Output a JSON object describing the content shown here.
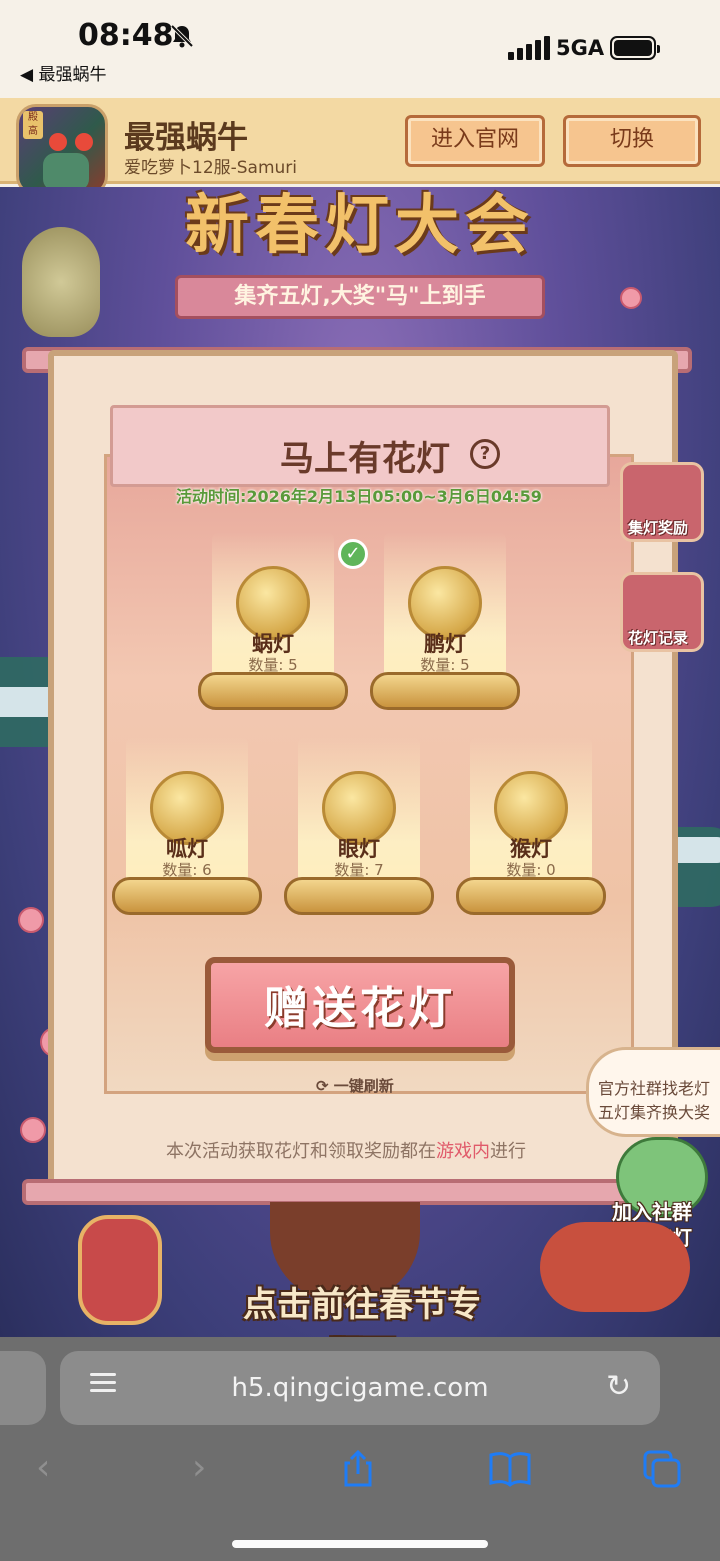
{
  "status": {
    "time": "08:48",
    "back_app": "◀ 最强蜗牛",
    "network": "5GA"
  },
  "gamebar": {
    "game_name": "最强蜗牛",
    "server": "爱吃萝卜12服-Samuri",
    "btn_site": "进入官网",
    "btn_switch": "切换"
  },
  "event": {
    "title": "新春灯大会",
    "subtitle": "集齐五灯,大奖\"马\"上到手",
    "panel_title": "马上有花灯",
    "period": "活动时间:2026年2月13日05:00~3月6日04:59",
    "lanterns": [
      {
        "name": "蜗灯",
        "qty": "数量: 5"
      },
      {
        "name": "鹏灯",
        "qty": "数量: 5"
      },
      {
        "name": "呱灯",
        "qty": "数量: 6"
      },
      {
        "name": "眼灯",
        "qty": "数量: 7"
      },
      {
        "name": "猴灯",
        "qty": "数量: 0"
      }
    ],
    "side_reward": "集灯奖励",
    "side_record": "花灯记录",
    "gift_button": "赠送花灯",
    "refresh": "一键刷新",
    "notice_pre": "本次活动获取花灯和领取奖励都在",
    "notice_em": "游戏内",
    "notice_post": "进行",
    "bubble_line1": "官方社群找老灯",
    "bubble_line2": "五灯集齐换大奖",
    "join_line1": "加入社群",
    "join_line2": "互赠花灯",
    "goto": "点击前往春节专题页"
  },
  "browser": {
    "url": "h5.qingcigame.com"
  },
  "colors": {
    "accent_blue": "#1f7cf5",
    "panel_pink": "#f2c9c9",
    "check_green": "#5fb55a"
  }
}
